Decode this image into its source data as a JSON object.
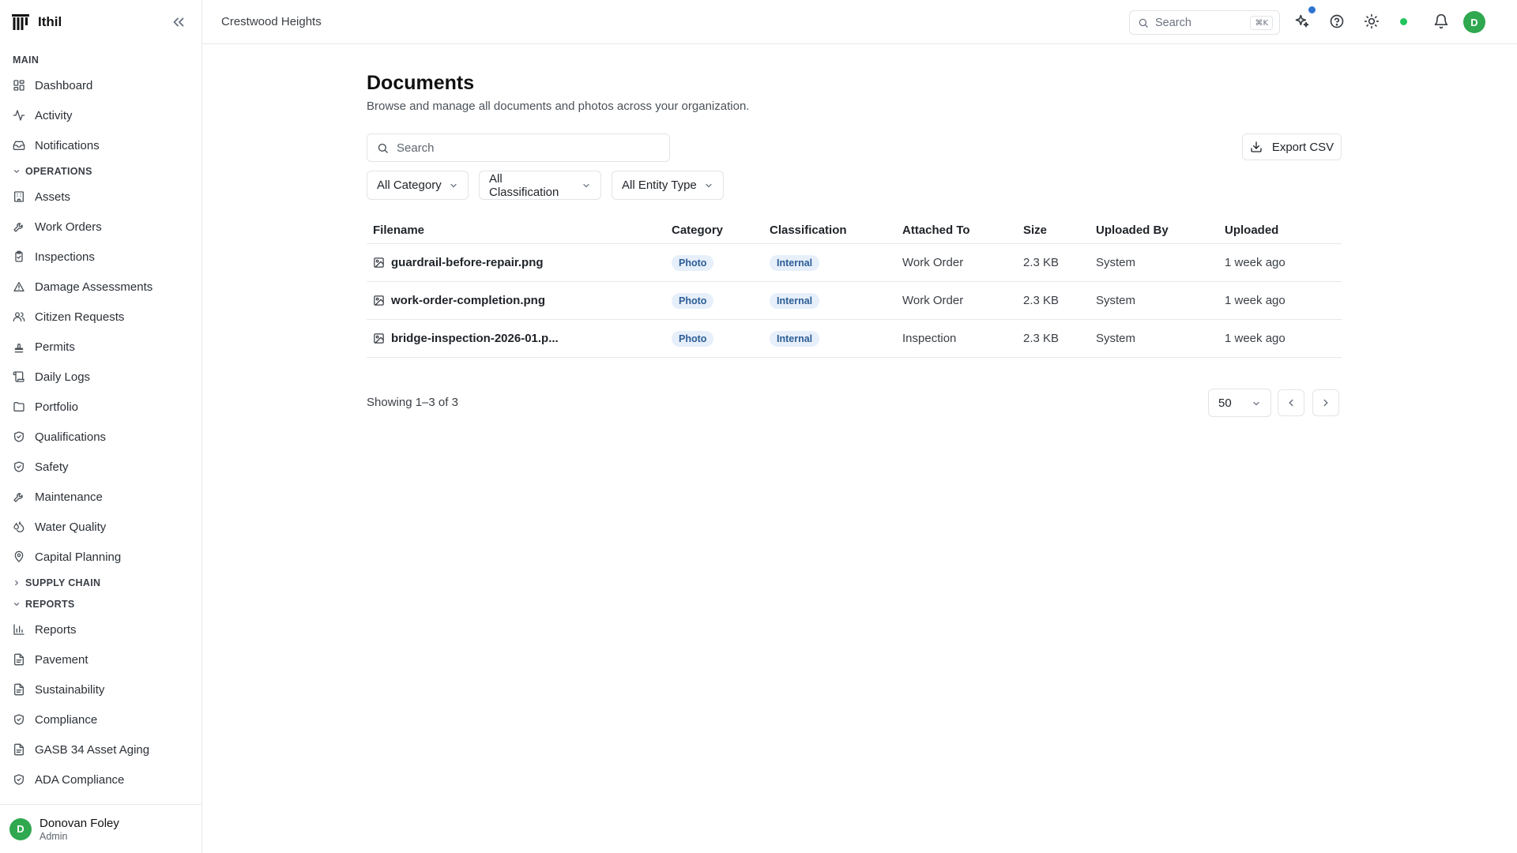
{
  "app": {
    "name": "Ithil"
  },
  "topbar": {
    "breadcrumb": "Crestwood Heights",
    "search_placeholder": "Search",
    "search_shortcut": "⌘K",
    "avatar_initial": "D"
  },
  "sidebar": {
    "sections": {
      "main": "MAIN",
      "operations": "OPERATIONS",
      "supply_chain": "SUPPLY CHAIN",
      "reports": "REPORTS"
    },
    "main_items": [
      {
        "label": "Dashboard",
        "icon": "dashboard-icon"
      },
      {
        "label": "Activity",
        "icon": "activity-icon"
      },
      {
        "label": "Notifications",
        "icon": "inbox-icon"
      }
    ],
    "operations_items": [
      {
        "label": "Assets",
        "icon": "building-icon"
      },
      {
        "label": "Work Orders",
        "icon": "wrench-icon"
      },
      {
        "label": "Inspections",
        "icon": "clipboard-check-icon"
      },
      {
        "label": "Damage Assessments",
        "icon": "warning-icon"
      },
      {
        "label": "Citizen Requests",
        "icon": "users-icon"
      },
      {
        "label": "Permits",
        "icon": "stamp-icon"
      },
      {
        "label": "Daily Logs",
        "icon": "scroll-icon"
      },
      {
        "label": "Portfolio",
        "icon": "folder-icon"
      },
      {
        "label": "Qualifications",
        "icon": "shield-check-icon"
      },
      {
        "label": "Safety",
        "icon": "shield-check-icon"
      },
      {
        "label": "Maintenance",
        "icon": "wrench-icon"
      },
      {
        "label": "Water Quality",
        "icon": "droplets-icon"
      },
      {
        "label": "Capital Planning",
        "icon": "map-pin-icon"
      }
    ],
    "reports_items": [
      {
        "label": "Reports",
        "icon": "bar-chart-icon"
      },
      {
        "label": "Pavement",
        "icon": "file-text-icon"
      },
      {
        "label": "Sustainability",
        "icon": "file-text-icon"
      },
      {
        "label": "Compliance",
        "icon": "shield-check-icon"
      },
      {
        "label": "GASB 34 Asset Aging",
        "icon": "file-text-icon"
      },
      {
        "label": "ADA Compliance",
        "icon": "shield-check-icon"
      }
    ],
    "user": {
      "initial": "D",
      "name": "Donovan Foley",
      "role": "Admin"
    }
  },
  "page": {
    "title": "Documents",
    "subtitle": "Browse and manage all documents and photos across your organization.",
    "search_placeholder": "Search",
    "export_label": "Export CSV",
    "filters": [
      "All Category",
      "All Classification",
      "All Entity Type"
    ]
  },
  "table": {
    "columns": [
      "Filename",
      "Category",
      "Classification",
      "Attached To",
      "Size",
      "Uploaded By",
      "Uploaded"
    ],
    "rows": [
      {
        "filename": "guardrail-before-repair.png",
        "category": "Photo",
        "classification": "Internal",
        "attached_to": "Work Order",
        "size": "2.3 KB",
        "uploaded_by": "System",
        "uploaded": "1 week ago"
      },
      {
        "filename": "work-order-completion.png",
        "category": "Photo",
        "classification": "Internal",
        "attached_to": "Work Order",
        "size": "2.3 KB",
        "uploaded_by": "System",
        "uploaded": "1 week ago"
      },
      {
        "filename": "bridge-inspection-2026-01.p...",
        "category": "Photo",
        "classification": "Internal",
        "attached_to": "Inspection",
        "size": "2.3 KB",
        "uploaded_by": "System",
        "uploaded": "1 week ago"
      }
    ]
  },
  "pagination": {
    "showing": "Showing 1–3 of 3",
    "page_size": "50"
  },
  "colors": {
    "accent_green": "#2fa84f",
    "badge_bg": "#e6effa",
    "badge_text": "#2c5d96",
    "status_online": "#22c55e",
    "notification_dot": "#2f74d0"
  }
}
